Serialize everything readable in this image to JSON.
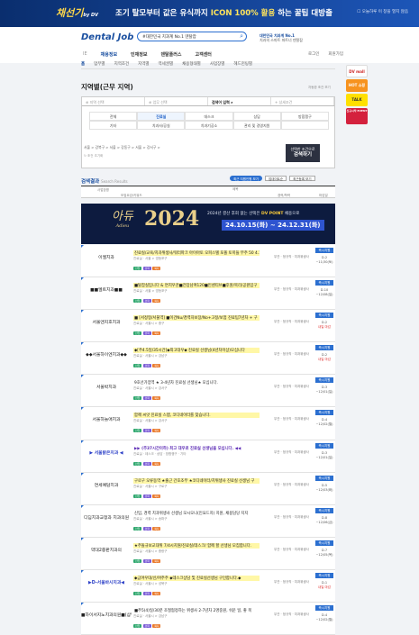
{
  "topbanner": {
    "logo": "채선기",
    "logo_by": "by DV",
    "ad": "조기 탈모부터 값은 유식까지",
    "ad_highlight": "ICON 100% 활용",
    "ad_tail": "하는 꿀팁 대방출",
    "close": "오늘하루 이 창을 열지 않음"
  },
  "header": {
    "brand": "Dental Job",
    "search_value": "#대한민국 치과계 No.1 덴탈잡",
    "h1": "대한민국 치과계 No.1",
    "h2": "치과의 스마트 파트너 덴탈잡",
    "links": [
      "로그인",
      "회원가입"
    ],
    "gnb": [
      "채용정보",
      "인재정보",
      "덴탈플러스",
      "고객센터"
    ],
    "gnb_prefix": "IE"
  },
  "subnav": [
    "홈",
    "업무별",
    "지역조건",
    "지역별",
    "역세권별",
    "채용형태별",
    "사업장별",
    "헤드헌팅별"
  ],
  "side": [
    "DV mall",
    "HOT 쇼핑",
    "토크",
    "TALK",
    "신규시작 EVENT"
  ],
  "page": {
    "title": "지역별(근무 지역)",
    "sort": "자동완 조건 보기"
  },
  "filter": {
    "tabs": [
      "지역 선택",
      "업무 선택",
      "검색어 입력",
      "상세조건"
    ],
    "regions": [
      "전체",
      "진료실",
      "데스크",
      "상담",
      "방합쟁구",
      "기타",
      "치과사/공실",
      "치과기공소",
      "관리 및 경영지원",
      ""
    ],
    "crumb": "서울 > 강북구 > 서울 > 강동구 > 서울 > 강서구 >",
    "reset": "조건 초기화",
    "btn_small": "선택한 조건으로",
    "btn_big": "검색하기"
  },
  "results": {
    "title": "검색결과",
    "title_en": "Search Results",
    "ctrls": [
      "최근 지원인원 보기",
      "업데이트순",
      "최근등록 보기"
    ],
    "cols": [
      "사업장명",
      "모집요강/키워드",
      "제목",
      "경력/학력",
      "마감일"
    ]
  },
  "banner": {
    "adieu": "아듀",
    "adieu_en": "Adieu",
    "year": "2024",
    "text": "2024년 결산 후회 없는 선택은",
    "highlight": "DV POINT",
    "text2": "채용으로",
    "date": "24.10.15(화) ~ 24.12.31(화)"
  },
  "rows": [
    {
      "name": "이엘치과",
      "title": "진료실/교육/치과위생사/워터파크 아이아토 오피스텔 포폴 토끼들 무주 50 4.15",
      "meta": "진료실 · 서울 > 영등포구",
      "cond": "무관 · 정규직 · 치과위생사",
      "btn": "즉시지원",
      "dday": "D-2",
      "dd2": "~11/30(토)",
      "red": false,
      "ty": true,
      "p": false,
      "nb": false,
      "tags": [
        "신입",
        "경력",
        "복지"
      ]
    },
    {
      "name": "■■엘트치과■■",
      "title": "■탈잡실입니다 & 면치우관■전장남여120■인센티브■후원/복리/공원입구",
      "meta": "진료실 · 서울 > 영등포구",
      "cond": "무관 · 정규직 · 치과위생사",
      "btn": "즉시지원",
      "dday": "D-10",
      "dd2": "~12/08(일)",
      "red": false,
      "ty": true,
      "p": false,
      "nb": false,
      "tags": [
        "신입",
        "경력",
        "복지"
      ]
    },
    {
      "name": "서울엔지호치과",
      "title": "■ [서정형/서울역] ■이건Nu/경력자보장/No+고정/보험 진료팀7년차 + 구",
      "meta": "진료실 · 서울시 > 중구",
      "cond": "무관 · 정규직 · 치과위생사",
      "btn": "즉시지원",
      "dday": "D-2",
      "dd2": "내일 마감",
      "red": true,
      "ty": true,
      "p": false,
      "nb": false,
      "tags": [
        "신입",
        "경력",
        "복지"
      ]
    },
    {
      "name": "◆◆서울하이엔치과◆◆",
      "title": "◆[주4.5일/35시간]◆최고대우◆ 진료실 선생님(4년차이상)모십니다",
      "meta": "진료실 · 서울시 > 강남구",
      "cond": "무관 · 정규직 · 치과위생사",
      "btn": "즉시지원",
      "dday": "D-2",
      "dd2": "내일 마감",
      "red": true,
      "ty": true,
      "p": false,
      "nb": false,
      "tags": [
        "신입",
        "경력",
        "복지"
      ]
    },
    {
      "name": "서울박치과",
      "title": "9호선가양역 ★ 3-4년차 진료실 선생님★ 모십니다.",
      "meta": "진료실 · 서울시 > 강서구",
      "cond": "무관 · 정규직 · 치과위생사",
      "btn": "즉시지원",
      "dday": "D-3",
      "dd2": "~12/01(일)",
      "red": false,
      "ty": false,
      "p": false,
      "nb": false,
      "tags": [
        "신입",
        "경력",
        "복지"
      ]
    },
    {
      "name": "서울하늘애치과",
      "title": "함께 씨앗 진료실 스탭, 코디네이터를 찾습니다.",
      "meta": "진료실 · 서울시 > 강서구",
      "cond": "무관 · 정규직 · 치과위생사",
      "btn": "즉시지원",
      "dday": "D-4",
      "dd2": "~12/02(월)",
      "red": false,
      "ty": true,
      "p": false,
      "nb": false,
      "tags": [
        "신입",
        "경력",
        "복지"
      ]
    },
    {
      "name": "▶ 서울밝은치과 ◀",
      "title": "▶▶ (주37시간이하) 최고 대우로 진료실 선생님을 모십니다. ◀◀",
      "meta": "진료실 · 데스크 · 상담 · 방합쟁구 · 기타",
      "cond": "무관 · 정규직 · 치과위생사",
      "btn": "즉시지원",
      "dday": "D-3",
      "dd2": "~12/01(일)",
      "red": false,
      "ty": false,
      "p": true,
      "nb": true,
      "tags": [
        "신입",
        "경력",
        "복지"
      ]
    },
    {
      "name": "연세예담치과",
      "title": "구로구 오류동역 ★출근 간호조무 ★코디네이터/치위생사 진료실 선생님 구",
      "meta": "진료실 · 서울시 > 구로구",
      "cond": "무관 · 정규직 · 치과위생사",
      "btn": "즉시지원",
      "dday": "D-5",
      "dd2": "~12/03(화)",
      "red": false,
      "ty": true,
      "p": false,
      "nb": false,
      "tags": [
        "신입",
        "경력",
        "복지"
      ]
    },
    {
      "name": "디딤치과교정과 치과의원",
      "title": "신입, 경력 치과위생사 선생님 모시오니(인요드지) 지원, 채용담당 지지",
      "meta": "진료실 · 서울시 > 송파구",
      "cond": "무관 · 정규직 · 치과위생사",
      "btn": "즉시지원",
      "dday": "D-8",
      "dd2": "~12/06(금)",
      "red": false,
      "ty": false,
      "p": false,
      "nb": false,
      "tags": [
        "신입",
        "경력",
        "복지"
      ]
    },
    {
      "name": "약대2중판치과의",
      "title": "★주돌규보교대위 7/4시지원/진료실/데스크/ 함께 할 선생님 모집합니다.",
      "meta": "진료실 · 서울시 > 중랑구",
      "cond": "무관 · 정규직 · 치과위생사",
      "btn": "즉시지원",
      "dday": "D-7",
      "dd2": "~12/05(목)",
      "red": false,
      "ty": true,
      "p": false,
      "nb": false,
      "tags": [
        "신입",
        "경력",
        "복지"
      ]
    },
    {
      "name": "▶D-서울바시치과◀",
      "title": "◆금여우대/신/여주주 ◆데스크상담 및 진료실선생님 구인합니다.◆",
      "meta": "진료실 · 서울시 > 성북구",
      "cond": "무관 · 정규직 · 치과위생사",
      "btn": "즉시지원",
      "dday": "D-1",
      "dd2": "내일 마감",
      "red": true,
      "ty": true,
      "p": false,
      "nb": true,
      "tags": [
        "신입",
        "경력",
        "복지"
      ]
    },
    {
      "name": "■하이서지노치과의원■(삼남구 선주역 도보1분)",
      "title": "■주5(4)일/30분 조절협정하는 위생사 2-7년차 2명중원, 쉬운 일, 좋 복",
      "meta": "진료실 · 서울시 > 강남구",
      "cond": "무관 · 정규직 · 치과위생사",
      "btn": "즉시지원",
      "dday": "D-4",
      "dd2": "~12/02(월)",
      "red": false,
      "ty": false,
      "p": false,
      "nb": false,
      "tags": [
        "신입",
        "경력",
        "복지"
      ]
    }
  ]
}
